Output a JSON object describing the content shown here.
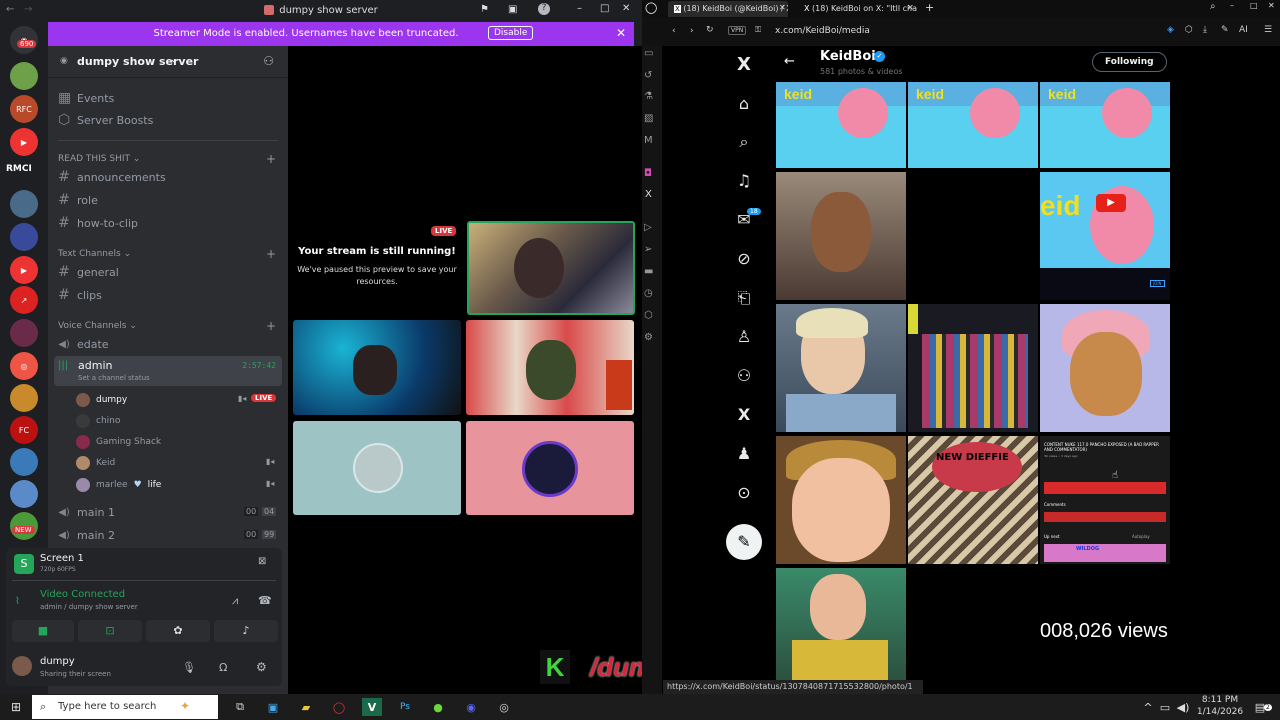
{
  "discord": {
    "window_title": "dumpy show server",
    "mention_badge": "690",
    "banner": {
      "message": "Streamer Mode is enabled. Usernames have been truncated.",
      "button": "Disable"
    },
    "server_name": "dumpy show server",
    "guilds": [
      "RMCI",
      "NEW"
    ],
    "menu": [
      "Events",
      "Server Boosts"
    ],
    "categories": {
      "read": "READ THIS SHIT",
      "text": "Text Channels",
      "voice": "Voice Channels"
    },
    "read_channels": [
      "announcements",
      "role",
      "how-to-clip"
    ],
    "text_channels": [
      "general",
      "clips"
    ],
    "voice": {
      "edate": "edate",
      "admin": "admin",
      "admin_time": "2:57:42",
      "admin_status": "Set a channel status",
      "users": [
        {
          "name": "dumpy",
          "badge": "LIVE"
        },
        {
          "name": "chino"
        },
        {
          "name": "Gaming Shack"
        },
        {
          "name": "Keid"
        },
        {
          "name": "marlee",
          "extra": "life"
        }
      ],
      "main1": {
        "name": "main 1",
        "a": "00",
        "b": "04"
      },
      "main2": {
        "name": "main 2",
        "a": "00",
        "b": "99"
      }
    },
    "screen_panel": {
      "title": "Screen 1",
      "quality": "720p 60FPS"
    },
    "voice_panel": {
      "status": "Video Connected",
      "location": "admin / dumpy show server"
    },
    "account": {
      "name": "dumpy",
      "status": "Sharing their screen"
    },
    "stage": {
      "live_badge": "LIVE",
      "paused_title": "Your stream is still running!",
      "paused_text": "We've paused this preview to save your resources."
    },
    "overlay_handle": "/dumpylive"
  },
  "browser": {
    "tabs": [
      "(18) KeidBoi (@KeidBoi) / X",
      "(18) KeidBoi on X: \"Itll cha"
    ],
    "vpn": "VPN",
    "url": "x.com/KeidBoi/media",
    "ai_label": "AI",
    "status_url": "https://x.com/KeidBoi/status/1307840871715532800/photo/1"
  },
  "x": {
    "profile_name": "KeidBoi",
    "count_text": "581 photos & videos",
    "follow_button": "Following",
    "msg_badge": "18",
    "media_labels": {
      "keid": "keid",
      "patrick": "eid",
      "yt_join": "JOIN",
      "wildog": "WILDOG",
      "views": "008,026 views"
    },
    "yt_card": {
      "title": "CONTENT NUKE 117.0 PANCHO EXPOSED (A BAD RAPPER AND COMMENTATOR)",
      "sub": "3K views • 3 days ago",
      "comments": "Comments",
      "upnext": "Up next",
      "autoplay": "Autoplay"
    },
    "album_text": "NEW DIEFFIE"
  },
  "taskbar": {
    "search_placeholder": "Type here to search",
    "time": "8:11 PM",
    "date": "1/14/2026",
    "notif": "2"
  },
  "colors": {
    "discord_bg": "#313338",
    "blurple": "#5865f2",
    "live_red": "#da373c",
    "green": "#23a55a",
    "banner": "#9b35ee",
    "x_blue": "#1d9bf0"
  }
}
